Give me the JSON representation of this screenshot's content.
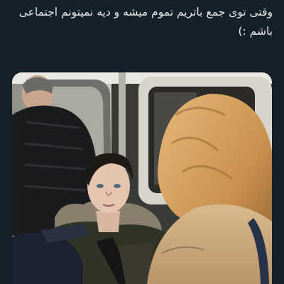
{
  "post": {
    "text": "وقتی توی جمع باتریم تموم میشه و دیه نمیتونم اجتماعی باشم :)"
  },
  "media": {
    "icon": "photo-icon"
  },
  "colors": {
    "background": "#15202b",
    "text": "#e7e9ea"
  }
}
